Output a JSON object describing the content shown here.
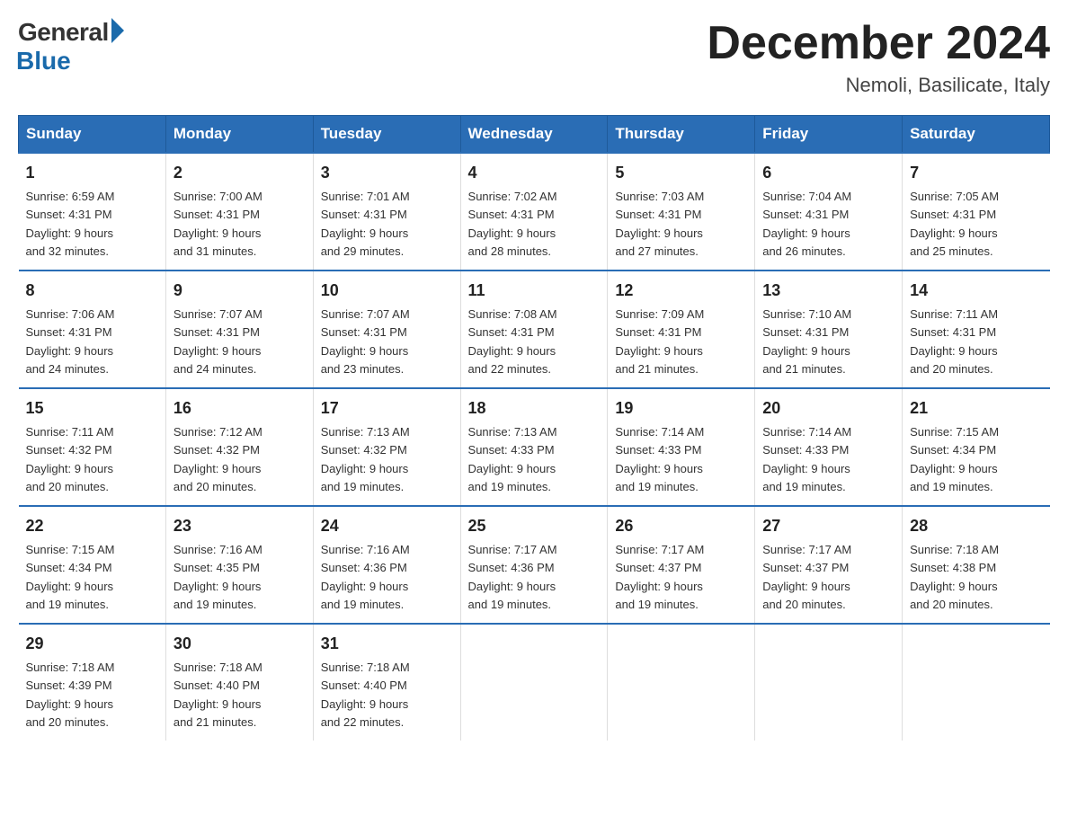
{
  "logo": {
    "general": "General",
    "blue": "Blue"
  },
  "title": {
    "month_year": "December 2024",
    "location": "Nemoli, Basilicate, Italy"
  },
  "days_of_week": [
    "Sunday",
    "Monday",
    "Tuesday",
    "Wednesday",
    "Thursday",
    "Friday",
    "Saturday"
  ],
  "weeks": [
    [
      {
        "day": "1",
        "sunrise": "6:59 AM",
        "sunset": "4:31 PM",
        "daylight": "9 hours and 32 minutes."
      },
      {
        "day": "2",
        "sunrise": "7:00 AM",
        "sunset": "4:31 PM",
        "daylight": "9 hours and 31 minutes."
      },
      {
        "day": "3",
        "sunrise": "7:01 AM",
        "sunset": "4:31 PM",
        "daylight": "9 hours and 29 minutes."
      },
      {
        "day": "4",
        "sunrise": "7:02 AM",
        "sunset": "4:31 PM",
        "daylight": "9 hours and 28 minutes."
      },
      {
        "day": "5",
        "sunrise": "7:03 AM",
        "sunset": "4:31 PM",
        "daylight": "9 hours and 27 minutes."
      },
      {
        "day": "6",
        "sunrise": "7:04 AM",
        "sunset": "4:31 PM",
        "daylight": "9 hours and 26 minutes."
      },
      {
        "day": "7",
        "sunrise": "7:05 AM",
        "sunset": "4:31 PM",
        "daylight": "9 hours and 25 minutes."
      }
    ],
    [
      {
        "day": "8",
        "sunrise": "7:06 AM",
        "sunset": "4:31 PM",
        "daylight": "9 hours and 24 minutes."
      },
      {
        "day": "9",
        "sunrise": "7:07 AM",
        "sunset": "4:31 PM",
        "daylight": "9 hours and 24 minutes."
      },
      {
        "day": "10",
        "sunrise": "7:07 AM",
        "sunset": "4:31 PM",
        "daylight": "9 hours and 23 minutes."
      },
      {
        "day": "11",
        "sunrise": "7:08 AM",
        "sunset": "4:31 PM",
        "daylight": "9 hours and 22 minutes."
      },
      {
        "day": "12",
        "sunrise": "7:09 AM",
        "sunset": "4:31 PM",
        "daylight": "9 hours and 21 minutes."
      },
      {
        "day": "13",
        "sunrise": "7:10 AM",
        "sunset": "4:31 PM",
        "daylight": "9 hours and 21 minutes."
      },
      {
        "day": "14",
        "sunrise": "7:11 AM",
        "sunset": "4:31 PM",
        "daylight": "9 hours and 20 minutes."
      }
    ],
    [
      {
        "day": "15",
        "sunrise": "7:11 AM",
        "sunset": "4:32 PM",
        "daylight": "9 hours and 20 minutes."
      },
      {
        "day": "16",
        "sunrise": "7:12 AM",
        "sunset": "4:32 PM",
        "daylight": "9 hours and 20 minutes."
      },
      {
        "day": "17",
        "sunrise": "7:13 AM",
        "sunset": "4:32 PM",
        "daylight": "9 hours and 19 minutes."
      },
      {
        "day": "18",
        "sunrise": "7:13 AM",
        "sunset": "4:33 PM",
        "daylight": "9 hours and 19 minutes."
      },
      {
        "day": "19",
        "sunrise": "7:14 AM",
        "sunset": "4:33 PM",
        "daylight": "9 hours and 19 minutes."
      },
      {
        "day": "20",
        "sunrise": "7:14 AM",
        "sunset": "4:33 PM",
        "daylight": "9 hours and 19 minutes."
      },
      {
        "day": "21",
        "sunrise": "7:15 AM",
        "sunset": "4:34 PM",
        "daylight": "9 hours and 19 minutes."
      }
    ],
    [
      {
        "day": "22",
        "sunrise": "7:15 AM",
        "sunset": "4:34 PM",
        "daylight": "9 hours and 19 minutes."
      },
      {
        "day": "23",
        "sunrise": "7:16 AM",
        "sunset": "4:35 PM",
        "daylight": "9 hours and 19 minutes."
      },
      {
        "day": "24",
        "sunrise": "7:16 AM",
        "sunset": "4:36 PM",
        "daylight": "9 hours and 19 minutes."
      },
      {
        "day": "25",
        "sunrise": "7:17 AM",
        "sunset": "4:36 PM",
        "daylight": "9 hours and 19 minutes."
      },
      {
        "day": "26",
        "sunrise": "7:17 AM",
        "sunset": "4:37 PM",
        "daylight": "9 hours and 19 minutes."
      },
      {
        "day": "27",
        "sunrise": "7:17 AM",
        "sunset": "4:37 PM",
        "daylight": "9 hours and 20 minutes."
      },
      {
        "day": "28",
        "sunrise": "7:18 AM",
        "sunset": "4:38 PM",
        "daylight": "9 hours and 20 minutes."
      }
    ],
    [
      {
        "day": "29",
        "sunrise": "7:18 AM",
        "sunset": "4:39 PM",
        "daylight": "9 hours and 20 minutes."
      },
      {
        "day": "30",
        "sunrise": "7:18 AM",
        "sunset": "4:40 PM",
        "daylight": "9 hours and 21 minutes."
      },
      {
        "day": "31",
        "sunrise": "7:18 AM",
        "sunset": "4:40 PM",
        "daylight": "9 hours and 22 minutes."
      },
      null,
      null,
      null,
      null
    ]
  ],
  "labels": {
    "sunrise": "Sunrise:",
    "sunset": "Sunset:",
    "daylight": "Daylight:"
  }
}
